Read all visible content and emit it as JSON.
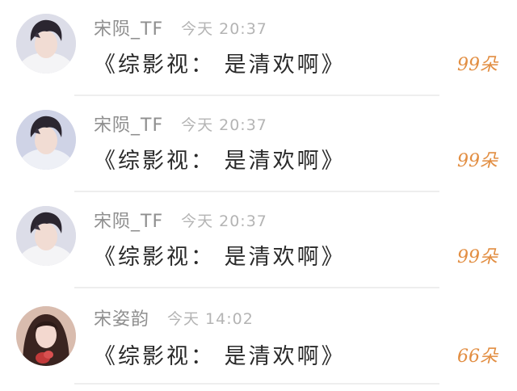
{
  "messages": [
    {
      "username": "宋陨_TF",
      "time": "今天 20:37",
      "text": "《综影视： 是清欢啊》",
      "count": "99朵",
      "avatar_icon": "boy-avatar"
    },
    {
      "username": "宋陨_TF",
      "time": "今天 20:37",
      "text": "《综影视： 是清欢啊》",
      "count": "99朵",
      "avatar_icon": "boy-avatar"
    },
    {
      "username": "宋陨_TF",
      "time": "今天 20:37",
      "text": "《综影视： 是清欢啊》",
      "count": "99朵",
      "avatar_icon": "boy-avatar"
    },
    {
      "username": "宋姿韵",
      "time": "今天 14:02",
      "text": "《综影视： 是清欢啊》",
      "count": "66朵",
      "avatar_icon": "girl-avatar"
    }
  ],
  "colors": {
    "count_accent": "#e28e42",
    "username": "#8f8f8f",
    "time": "#b4b4b4",
    "text": "#2a2a2a"
  }
}
